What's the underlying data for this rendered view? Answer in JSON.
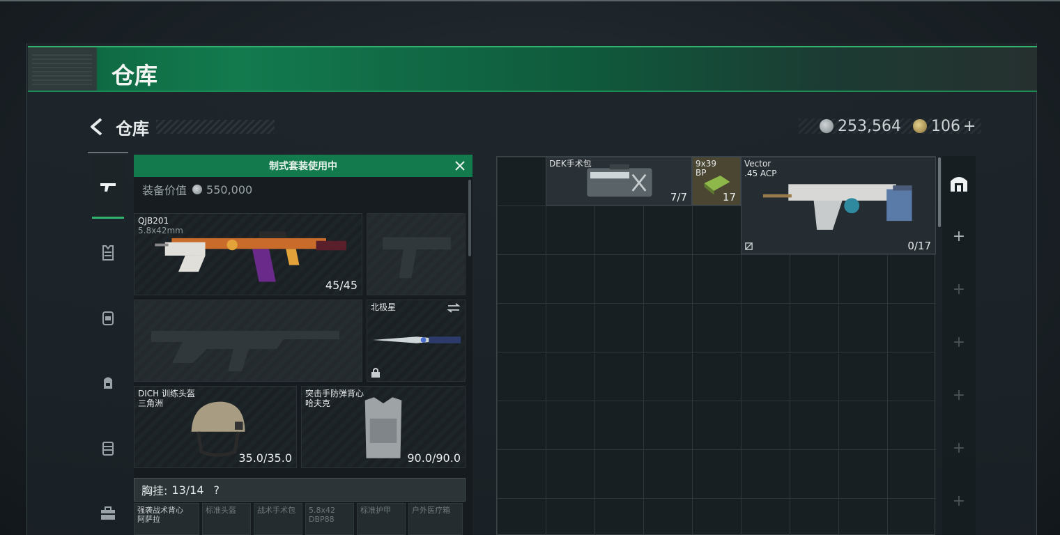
{
  "window": {
    "title": "仓库"
  },
  "header": {
    "back_label": "仓库"
  },
  "currency": {
    "silver": "253,564",
    "gold": "106",
    "gold_add": "+"
  },
  "nav": [
    {
      "name": "weapon-icon"
    },
    {
      "name": "armor-icon"
    },
    {
      "name": "helmet-icon"
    },
    {
      "name": "backpack-icon"
    },
    {
      "name": "vest-icon"
    },
    {
      "name": "case-icon"
    }
  ],
  "loadout": {
    "kit_banner": "制式套装使用中",
    "equip_value_label": "装备价值",
    "equip_value": "550,000",
    "primary": {
      "name": "QJB201",
      "ammo": "5.8x42mm",
      "count": "45/45"
    },
    "melee": {
      "name": "北极星"
    },
    "helmet": {
      "name": "DICH 训练头盔",
      "sub": "三角洲",
      "count": "35.0/35.0"
    },
    "armor": {
      "name": "突击手防弹背心",
      "sub": "哈夫克",
      "count": "90.0/90.0"
    },
    "chest_rig": {
      "label": "胸挂:",
      "value": "13/14",
      "help": "?"
    },
    "bag_items": [
      {
        "line1": "强袭战术背心",
        "line2": "阿萨拉"
      },
      {
        "line1": "标准头盔",
        "line2": ""
      },
      {
        "line1": "战术手术包",
        "line2": ""
      },
      {
        "line1": "5.8x42",
        "line2": "DBP88"
      },
      {
        "line1": "标准护甲",
        "line2": ""
      },
      {
        "line1": "户外医疗箱",
        "line2": ""
      }
    ]
  },
  "stash": {
    "items": [
      {
        "name": "DEK手术包",
        "count": "7/7"
      },
      {
        "name": "9x39",
        "sub": "BP",
        "count": "17"
      },
      {
        "name": "Vector",
        "sub": ".45 ACP",
        "count": "0/17"
      }
    ]
  },
  "right_tabs": {
    "add_symbol": "+"
  },
  "colors": {
    "accent": "#137a4e",
    "accent_bright": "#2fb36e"
  }
}
